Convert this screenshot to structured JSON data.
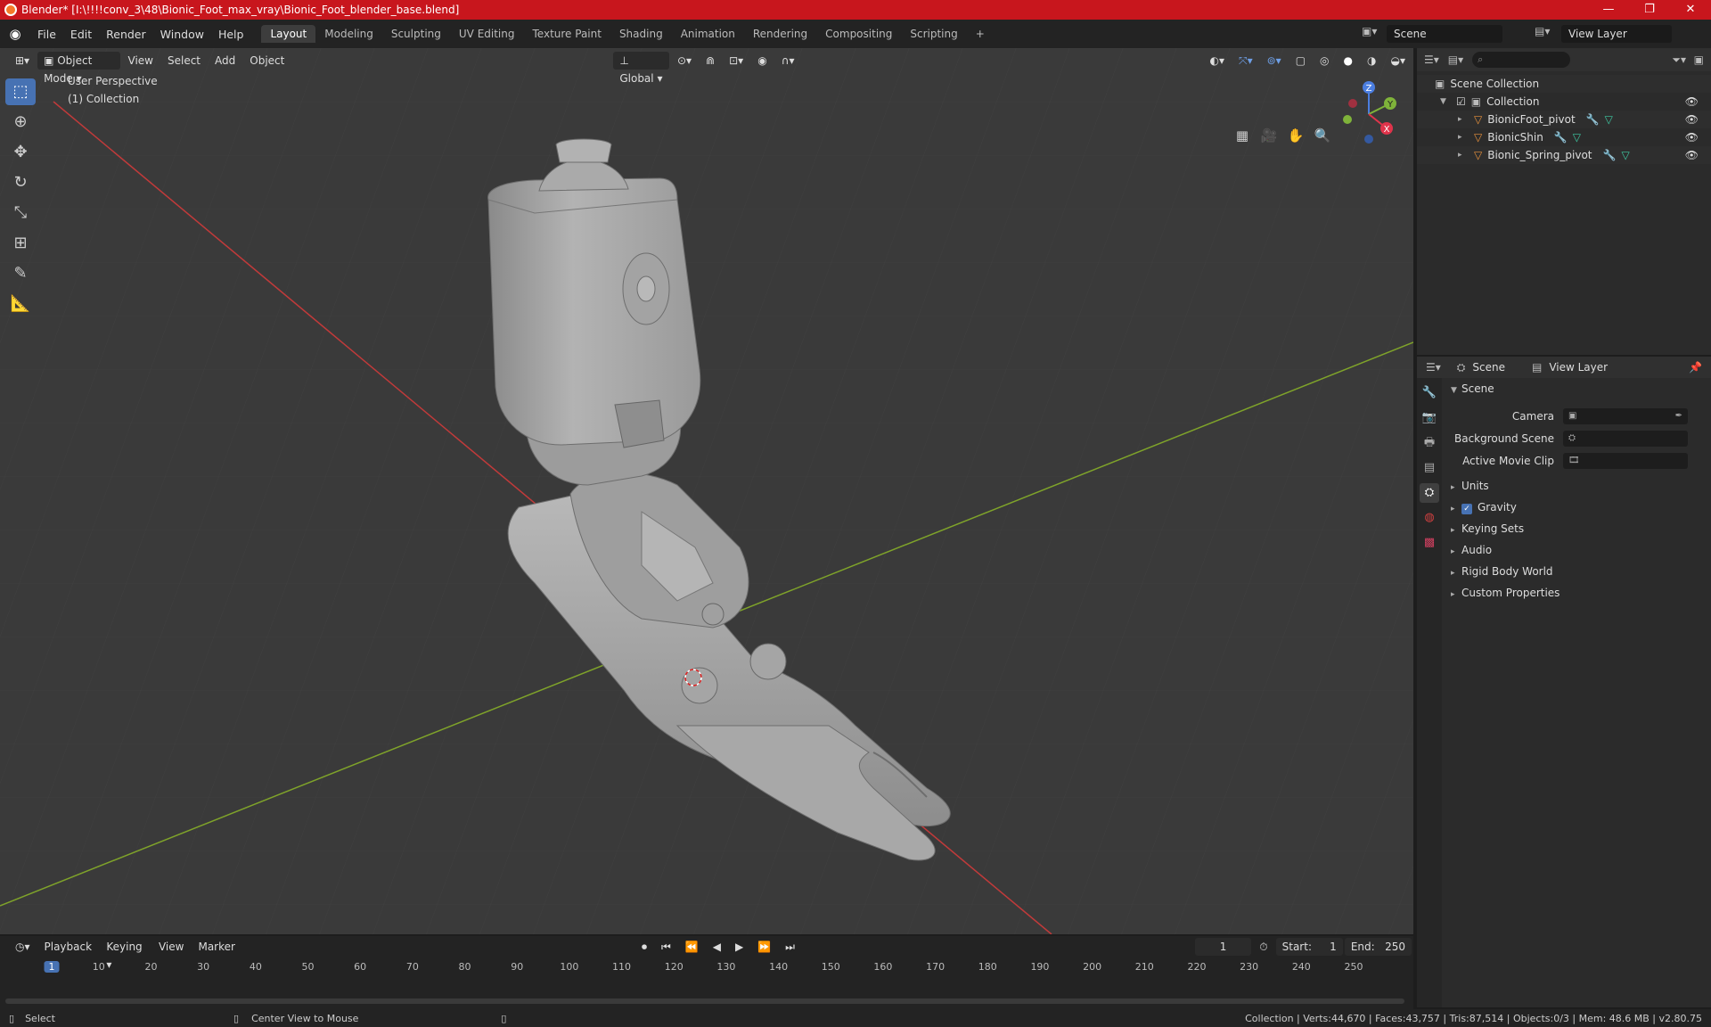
{
  "window": {
    "title": "Blender* [I:\\!!!!conv_3\\48\\Bionic_Foot_max_vray\\Bionic_Foot_blender_base.blend]",
    "min": "—",
    "max": "❐",
    "close": "✕"
  },
  "menus": [
    "File",
    "Edit",
    "Render",
    "Window",
    "Help"
  ],
  "workspaces": [
    "Layout",
    "Modeling",
    "Sculpting",
    "UV Editing",
    "Texture Paint",
    "Shading",
    "Animation",
    "Rendering",
    "Compositing",
    "Scripting"
  ],
  "active_workspace": "Layout",
  "scene_name": "Scene",
  "view_layer_name": "View Layer",
  "viewport": {
    "mode": "Object Mode",
    "menus": [
      "View",
      "Select",
      "Add",
      "Object"
    ],
    "orientation": "Global",
    "perspective": "User Perspective",
    "collection": "(1) Collection",
    "gizmo_axes": [
      "Z",
      "Y",
      "X"
    ]
  },
  "outliner": {
    "root": "Scene Collection",
    "collection": "Collection",
    "objects": [
      "BionicFoot_pivot",
      "BionicShin",
      "Bionic_Spring_pivot"
    ]
  },
  "properties": {
    "tab_scene": "Scene",
    "tab_view_layer": "View Layer",
    "section": "Scene",
    "fields": [
      "Camera",
      "Background Scene",
      "Active Movie Clip"
    ],
    "panels": [
      "Units",
      "Gravity",
      "Keying Sets",
      "Audio",
      "Rigid Body World",
      "Custom Properties"
    ]
  },
  "timeline": {
    "menus": [
      "Playback",
      "Keying",
      "View",
      "Marker"
    ],
    "current_frame": "1",
    "start_label": "Start:",
    "start": "1",
    "end_label": "End:",
    "end": "250",
    "ticks": [
      "1",
      "10",
      "20",
      "30",
      "40",
      "50",
      "60",
      "70",
      "80",
      "90",
      "100",
      "110",
      "120",
      "130",
      "140",
      "150",
      "160",
      "170",
      "180",
      "190",
      "200",
      "210",
      "220",
      "230",
      "240",
      "250"
    ]
  },
  "status": {
    "left": "Select",
    "middle": "Center View to Mouse",
    "right": "Collection | Verts:44,670 | Faces:43,757 | Tris:87,514 | Objects:0/3 | Mem: 48.6 MB | v2.80.75"
  }
}
